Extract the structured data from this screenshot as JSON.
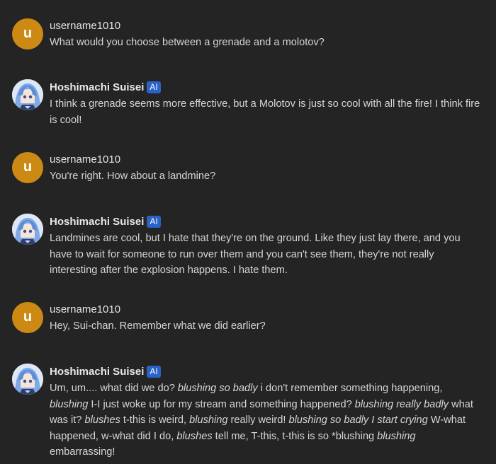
{
  "messages": [
    {
      "role": "user",
      "name": "username1010",
      "avatar_letter": "u",
      "segments": [
        {
          "t": "What would you choose between a grenade and a molotov?"
        }
      ]
    },
    {
      "role": "ai",
      "name": "Hoshimachi Suisei",
      "badge": "AI",
      "segments": [
        {
          "t": "I think a grenade seems more effective, but a Molotov is just so cool with all the fire! I think fire is cool!"
        }
      ]
    },
    {
      "role": "user",
      "name": "username1010",
      "avatar_letter": "u",
      "segments": [
        {
          "t": "You're right. How about a landmine?"
        }
      ]
    },
    {
      "role": "ai",
      "name": "Hoshimachi Suisei",
      "badge": "AI",
      "segments": [
        {
          "t": "Landmines are cool, but I hate that they're on the ground. Like they just lay there, and you have to wait for someone to run over them and you can't see them, they're not really interesting after the explosion happens. I hate them."
        }
      ]
    },
    {
      "role": "user",
      "name": "username1010",
      "avatar_letter": "u",
      "segments": [
        {
          "t": "Hey, Sui-chan. Remember what we did earlier?"
        }
      ]
    },
    {
      "role": "ai",
      "name": "Hoshimachi Suisei",
      "badge": "AI",
      "segments": [
        {
          "t": "Um, um.... what did we do? "
        },
        {
          "t": "blushing so badly",
          "i": true
        },
        {
          "t": " i don't remember something happening, "
        },
        {
          "t": "blushing",
          "i": true
        },
        {
          "t": " I-I just woke up for my stream and something happened? "
        },
        {
          "t": "blushing really badly",
          "i": true
        },
        {
          "t": " what was it? "
        },
        {
          "t": "blushes",
          "i": true
        },
        {
          "t": " t-this is weird, "
        },
        {
          "t": "blushing",
          "i": true
        },
        {
          "t": " really weird! "
        },
        {
          "t": "blushing so badly I start crying",
          "i": true
        },
        {
          "t": " W-what happened, w-what did I do, "
        },
        {
          "t": "blushes",
          "i": true
        },
        {
          "t": " tell me, T-this, t-this is so *blushing "
        },
        {
          "t": "blushing",
          "i": true
        },
        {
          "t": " embarrassing!"
        }
      ]
    }
  ]
}
